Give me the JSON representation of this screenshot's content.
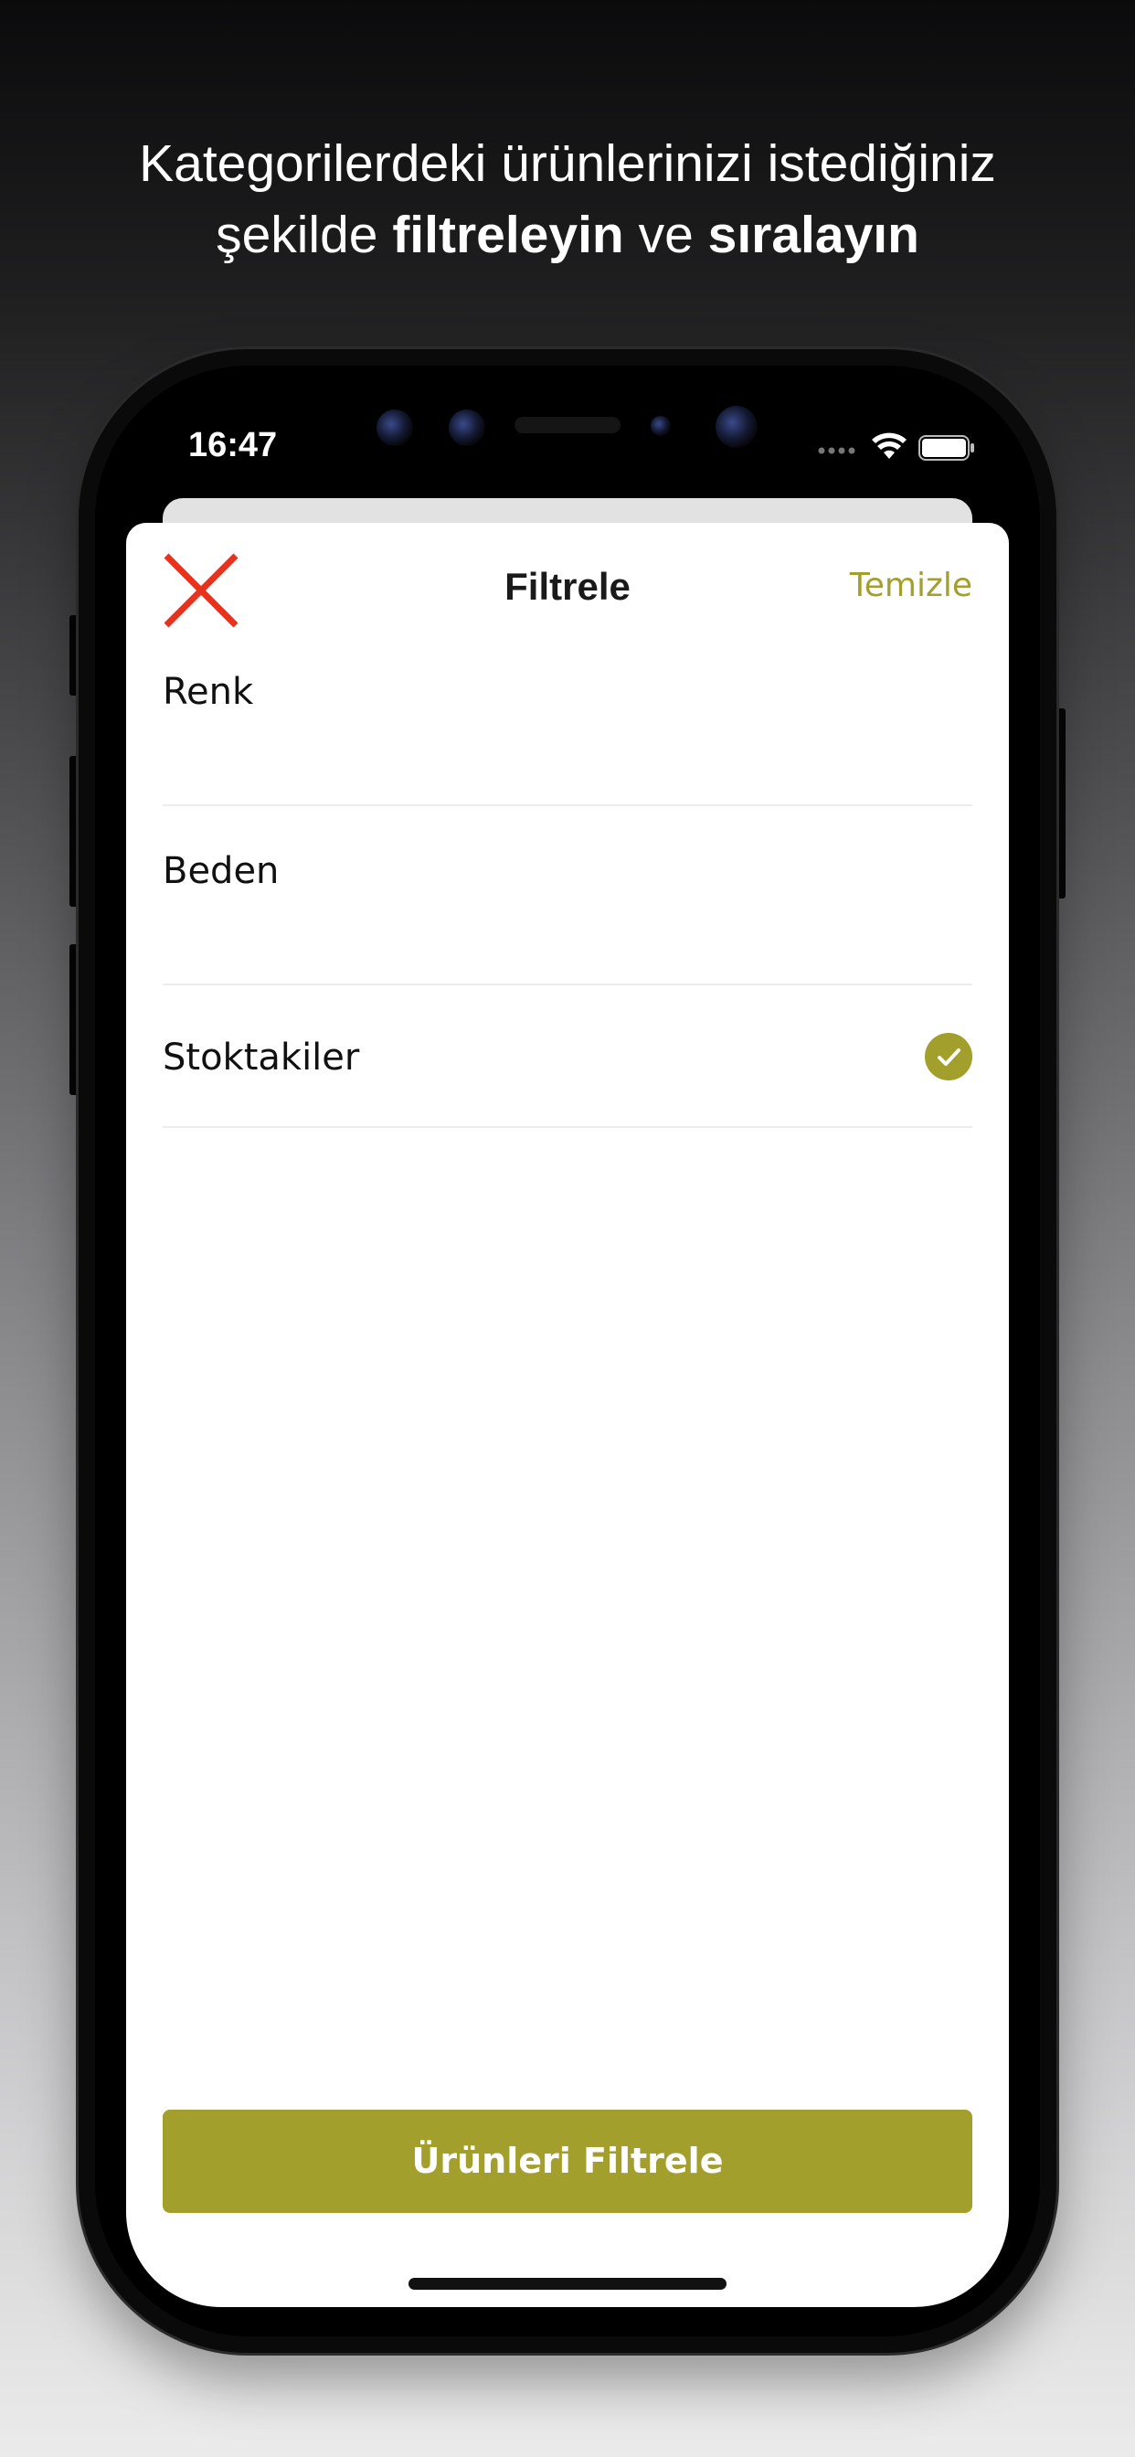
{
  "headline": {
    "line1": "Kategorilerdeki ürünlerinizi istediğiniz",
    "line2_pre": "şekilde ",
    "line2_bold1": "filtreleyin",
    "line2_mid": " ve ",
    "line2_bold2": "sıralayın"
  },
  "status_bar": {
    "time": "16:47",
    "icons": [
      "signal-dots-icon",
      "wifi-icon",
      "battery-icon"
    ]
  },
  "header": {
    "close_icon": "close-x-icon",
    "title": "Filtrele",
    "clear_label": "Temizle"
  },
  "filters": [
    {
      "label": "Renk",
      "checked": false
    },
    {
      "label": "Beden",
      "checked": false
    },
    {
      "label": "Stoktakiler",
      "checked": true
    }
  ],
  "apply_button": {
    "label": "Ürünleri Filtrele"
  },
  "colors": {
    "accent": "#a39f2c",
    "close_icon": "#e8321e",
    "text": "#111111",
    "divider": "#ececec"
  }
}
